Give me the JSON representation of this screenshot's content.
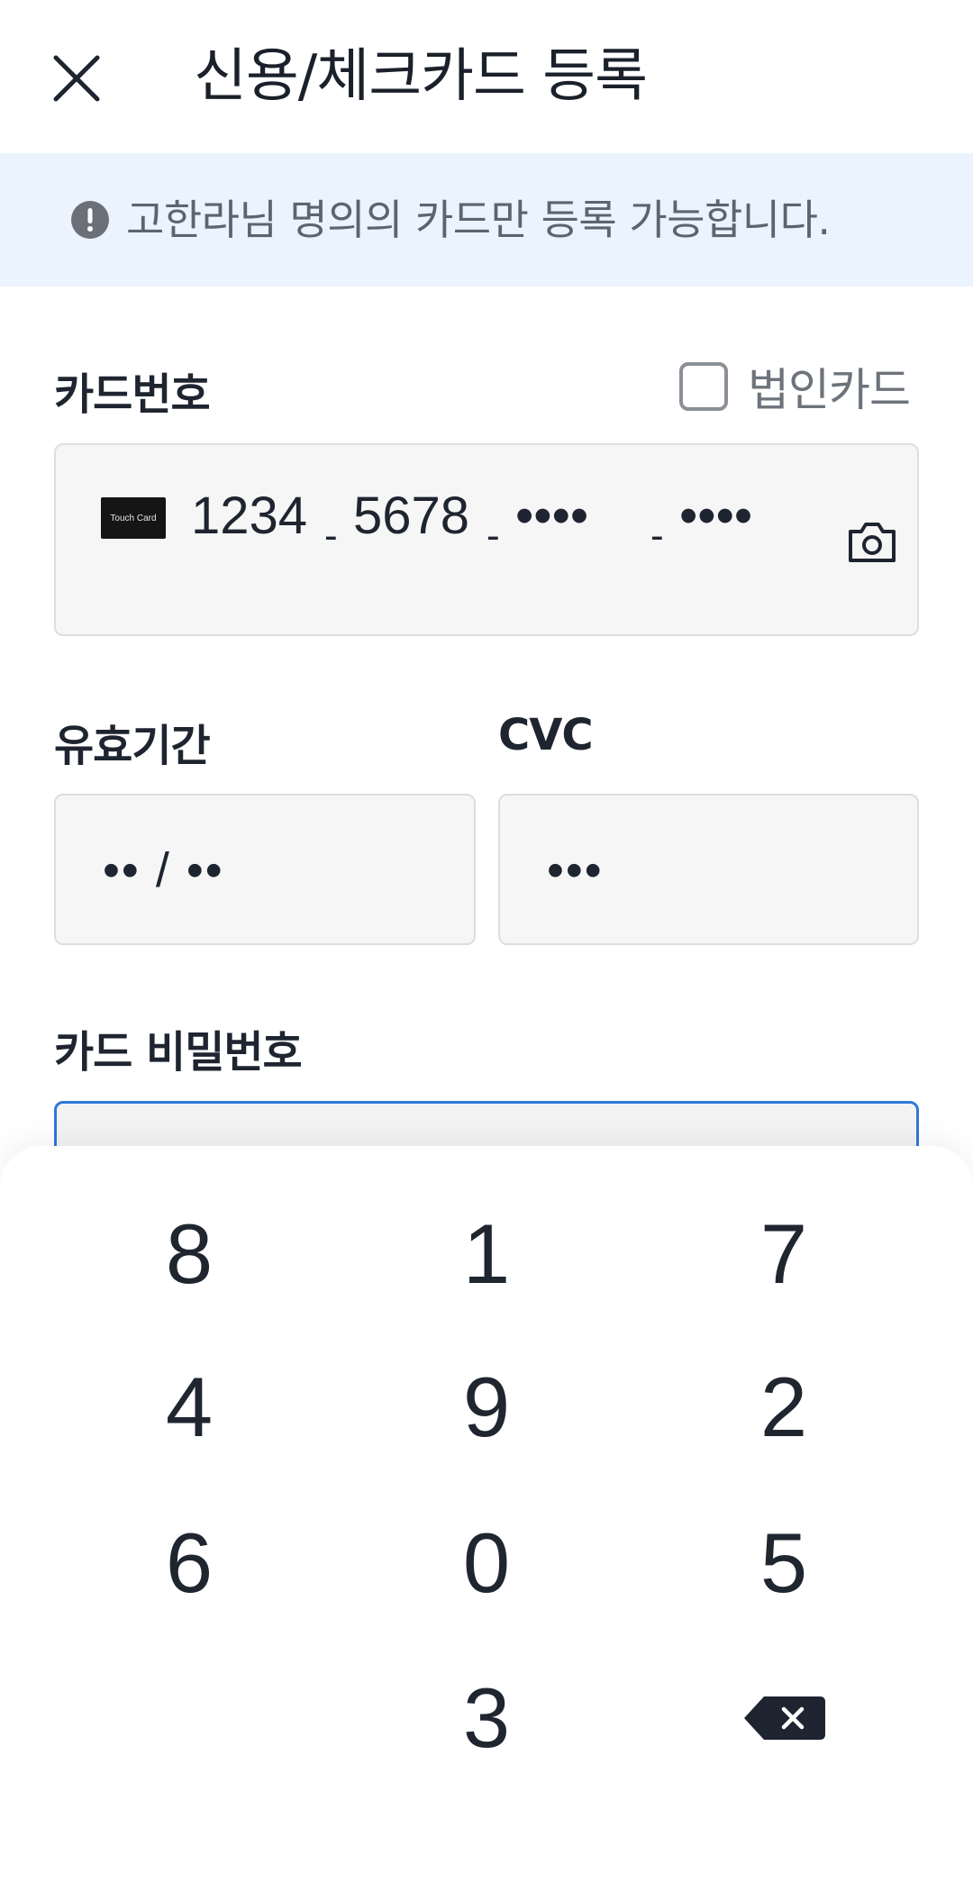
{
  "header": {
    "title": "신용/체크카드 등록",
    "close_icon": "close-icon"
  },
  "notice": {
    "icon": "exclamation-circle-icon",
    "text": "고한라님 명의의 카드만 등록 가능합니다."
  },
  "card_number": {
    "label": "카드번호",
    "corporate_checkbox_label": "법인카드",
    "corporate_checked": false,
    "brand_logo_text": "Touch Card",
    "groups": [
      "1234",
      "5678",
      "••••",
      "••••"
    ],
    "separator": "-",
    "scan_icon": "camera-icon"
  },
  "expiry": {
    "label": "유효기간",
    "value": "•• / ••"
  },
  "cvc": {
    "label": "CVC",
    "value": "•••"
  },
  "card_password": {
    "label": "카드 비밀번호",
    "value": ""
  },
  "keypad": {
    "keys": [
      "8",
      "1",
      "7",
      "4",
      "9",
      "2",
      "6",
      "0",
      "5",
      "3"
    ],
    "backspace_icon": "backspace-icon"
  },
  "colors": {
    "accent": "#2f78d7",
    "notice_bg": "#eaf3fe",
    "field_bg": "#f6f6f6"
  }
}
